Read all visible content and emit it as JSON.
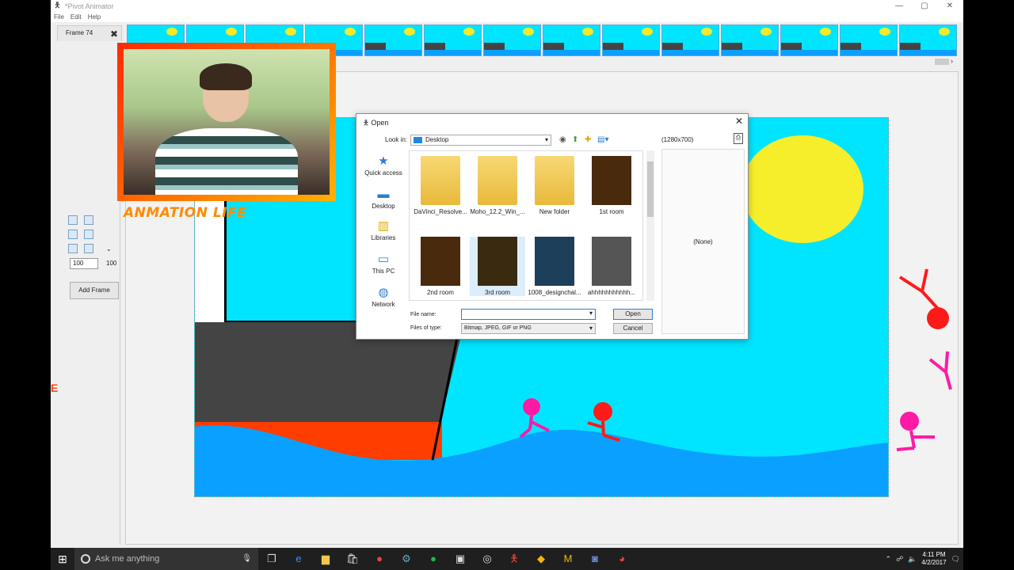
{
  "window": {
    "title": "*Pivot Animator",
    "minimize": "—",
    "maximize": "▢",
    "close": "✕"
  },
  "menu": [
    "File",
    "Edit",
    "Help"
  ],
  "frame_tab": {
    "label": "Frame 74",
    "close": "✖"
  },
  "frame_thumbnails_count": 14,
  "left_tools": {
    "size_value": "100",
    "size_label": "100",
    "add_frame": "Add Frame"
  },
  "overlay": {
    "label": "ANMATION LIFE"
  },
  "side_marker": "E",
  "dialog": {
    "title": "Open",
    "look_in_label": "Look in:",
    "look_in_value": "Desktop",
    "preview_size": "(1280x700)",
    "preview_none": "(None)",
    "places": [
      {
        "label": "Quick access",
        "icon": "star-icon"
      },
      {
        "label": "Desktop",
        "icon": "desktop-icon"
      },
      {
        "label": "Libraries",
        "icon": "libraries-icon"
      },
      {
        "label": "This PC",
        "icon": "pc-icon"
      },
      {
        "label": "Network",
        "icon": "network-icon"
      }
    ],
    "files": [
      {
        "name": "DaVinci_Resolve...",
        "kind": "folder"
      },
      {
        "name": "Moho_12.2_Win_...",
        "kind": "folder"
      },
      {
        "name": "New folder",
        "kind": "folder"
      },
      {
        "name": "1st room",
        "kind": "image"
      },
      {
        "name": "2nd room",
        "kind": "image"
      },
      {
        "name": "3rd room",
        "kind": "image"
      },
      {
        "name": "1008_designchal...",
        "kind": "image"
      },
      {
        "name": "ahhhhhhhhhhh...",
        "kind": "image"
      }
    ],
    "file_name_label": "File name:",
    "file_name_value": "",
    "files_of_type_label": "Files of type:",
    "files_of_type_value": "Bitmap, JPEG, GIF or PNG",
    "open_button": "Open",
    "cancel_button": "Cancel"
  },
  "taskbar": {
    "search_placeholder": "Ask me anything",
    "time": "4:11 PM",
    "date": "4/2/2017"
  },
  "colors": {
    "sky": "#00e5ff",
    "sun": "#f6ee2b",
    "sea": "#0aa0ff",
    "accent": "#ff3d00"
  }
}
